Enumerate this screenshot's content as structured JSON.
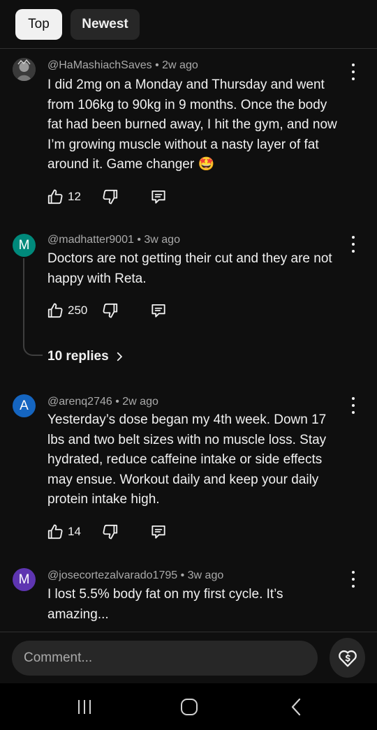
{
  "tabs": {
    "top": "Top",
    "newest": "Newest"
  },
  "comments": [
    {
      "handle": "@HaMashiachSaves",
      "age": "2w ago",
      "avatar_letter": "",
      "avatar_color": "#5a5a5a",
      "lines": [
        "I did 2mg on a Monday and Thursday and went",
        "from 106kg to 90kg in 9 months. Once the body",
        "fat had been burned away, I hit the gym, and now",
        "I’m growing muscle without a nasty layer of fat",
        "around it. Game changer 🤩"
      ],
      "likes": "12"
    },
    {
      "handle": "@madhatter9001",
      "age": "3w ago",
      "avatar_letter": "M",
      "avatar_color": "#00897b",
      "lines": [
        "Doctors are not getting their cut and they are not",
        "happy with Reta."
      ],
      "likes": "250",
      "replies": "10 replies"
    },
    {
      "handle": "@arenq2746",
      "age": "2w ago",
      "avatar_letter": "A",
      "avatar_color": "#1565c0",
      "lines": [
        "Yesterday’s dose began my 4th week. Down 17",
        "lbs and two belt sizes with no muscle loss. Stay",
        "hydrated, reduce caffeine intake or side effects",
        "may ensue. Workout daily and keep your daily",
        "protein intake high."
      ],
      "likes": "14"
    },
    {
      "handle": "@josecortezalvarado1795",
      "age": "3w ago",
      "avatar_letter": "M",
      "avatar_color": "#5e35b1",
      "lines": [
        "I lost 5.5%  body fat on my first cycle. It’s",
        "amazing..."
      ]
    }
  ],
  "composer": {
    "placeholder": "Comment..."
  },
  "icons": {
    "like": "thumbs-up-icon",
    "dislike": "thumbs-down-icon",
    "reply": "reply-icon",
    "more": "more-vertical-icon",
    "thanks": "super-thanks-icon"
  }
}
